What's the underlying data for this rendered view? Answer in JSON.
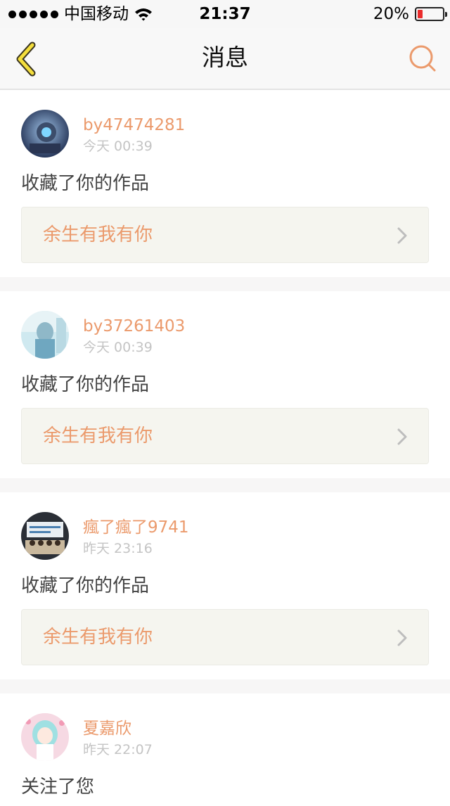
{
  "status_bar": {
    "carrier": "中国移动",
    "time": "21:37",
    "battery_percent": "20%",
    "battery_level": 0.2,
    "battery_color": "#ea2c2c"
  },
  "nav": {
    "title": "消息",
    "back_icon": "chevron-left-icon",
    "search_icon": "search-icon",
    "accent_color": "#eb9a6c"
  },
  "notifications": [
    {
      "user": "by47474281",
      "time": "今天 00:39",
      "action": "收藏了你的作品",
      "work_title": "余生有我有你"
    },
    {
      "user": "by37261403",
      "time": "今天 00:39",
      "action": "收藏了你的作品",
      "work_title": "余生有我有你"
    },
    {
      "user": "瘋了瘋了9741",
      "time": "昨天 23:16",
      "action": "收藏了你的作品",
      "work_title": "余生有我有你"
    },
    {
      "user": "夏嘉欣",
      "time": "昨天 22:07",
      "action": "关注了您"
    }
  ]
}
